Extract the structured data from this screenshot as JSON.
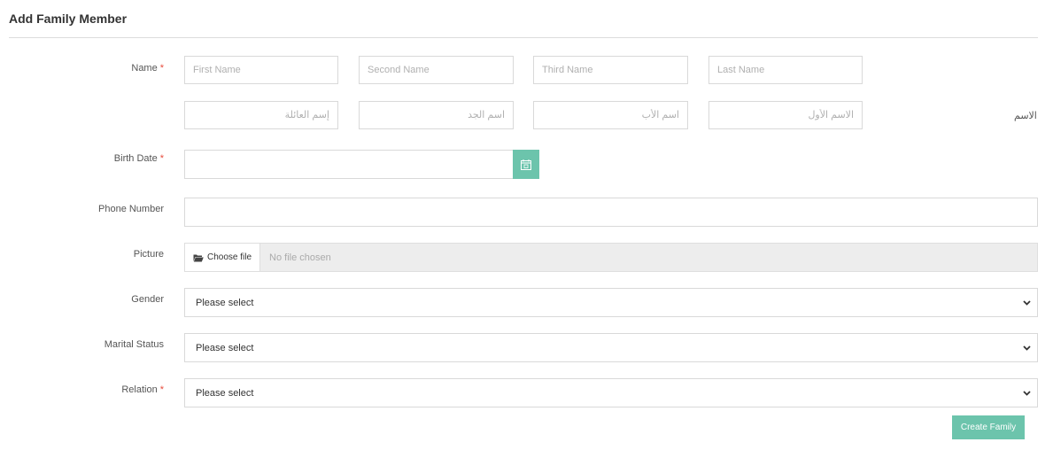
{
  "page": {
    "title": "Add Family Member"
  },
  "form": {
    "name": {
      "label": "Name",
      "required_mark": "*",
      "ar_label": "الاسم",
      "first_placeholder": "First Name",
      "second_placeholder": "Second Name",
      "third_placeholder": "Third Name",
      "last_placeholder": "Last Name",
      "ar_family_placeholder": "إسم العائلة",
      "ar_grandfather_placeholder": "اسم الجد",
      "ar_father_placeholder": "اسم الأب",
      "ar_first_placeholder": "الاسم الأول"
    },
    "birth_date": {
      "label": "Birth Date",
      "required_mark": "*",
      "value": "",
      "icon": "calendar-icon"
    },
    "phone": {
      "label": "Phone Number",
      "value": ""
    },
    "picture": {
      "label": "Picture",
      "button_label": "Choose file",
      "status": "No file chosen",
      "icon": "folder-open-icon"
    },
    "gender": {
      "label": "Gender",
      "selected": "Please select"
    },
    "marital_status": {
      "label": "Marital Status",
      "selected": "Please select"
    },
    "relation": {
      "label": "Relation",
      "required_mark": "*",
      "selected": "Please select"
    },
    "submit_label": "Create Family"
  },
  "colors": {
    "accent": "#6cc4ac",
    "required": "#e74c3c",
    "border": "#d9d9d9"
  }
}
